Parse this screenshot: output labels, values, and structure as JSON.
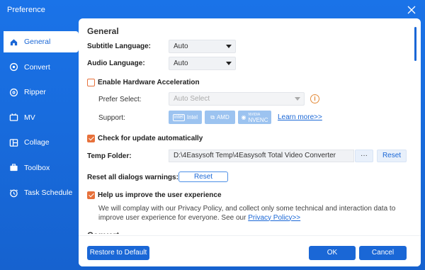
{
  "window": {
    "title": "Preference"
  },
  "sidebar": {
    "items": [
      {
        "label": "General",
        "icon": "home-icon",
        "active": true
      },
      {
        "label": "Convert",
        "icon": "convert-icon"
      },
      {
        "label": "Ripper",
        "icon": "disc-icon"
      },
      {
        "label": "MV",
        "icon": "mv-icon"
      },
      {
        "label": "Collage",
        "icon": "collage-icon"
      },
      {
        "label": "Toolbox",
        "icon": "toolbox-icon"
      },
      {
        "label": "Task Schedule",
        "icon": "clock-icon"
      }
    ]
  },
  "general": {
    "heading": "General",
    "subtitle_language": {
      "label": "Subtitle Language:",
      "value": "Auto"
    },
    "audio_language": {
      "label": "Audio Language:",
      "value": "Auto"
    },
    "hardware_accel": {
      "label": "Enable Hardware Acceleration",
      "checked": false
    },
    "prefer_select": {
      "label": "Prefer Select:",
      "value": "Auto Select"
    },
    "support": {
      "label": "Support:",
      "intel": "Intel",
      "intel_mark": "intel",
      "amd": "AMD",
      "nvidia_top": "NVIDIA",
      "nvidia": "NVENC",
      "learn_more": "Learn more>>"
    },
    "check_update": {
      "label": "Check for update automatically",
      "checked": true
    },
    "temp_folder": {
      "label": "Temp Folder:",
      "value": "D:\\4Easysoft Temp\\4Easysoft Total Video Converter",
      "browse": "···",
      "reset": "Reset"
    },
    "reset_dialogs": {
      "label": "Reset all dialogs warnings:",
      "button": "Reset"
    },
    "improve": {
      "label": "Help us improve the user experience",
      "checked": true,
      "text": "We will complay with our Privacy Policy, and collect only some technical and interaction data to improve user experience for everyone. See our",
      "link": "Privacy Policy>>"
    },
    "next_section_partial": "Convert"
  },
  "footer": {
    "restore": "Restore to Default",
    "ok": "OK",
    "cancel": "Cancel"
  }
}
